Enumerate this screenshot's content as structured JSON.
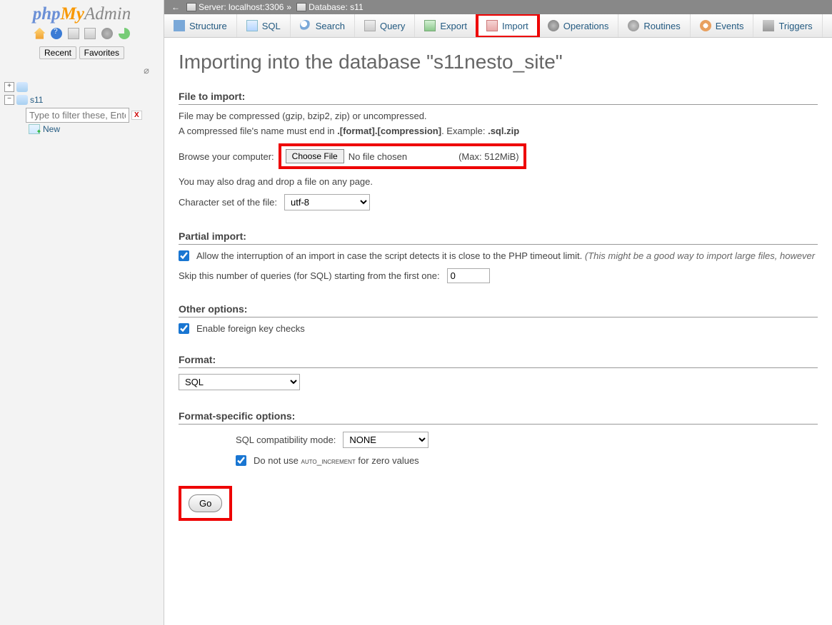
{
  "logo": {
    "p1": "php",
    "p2": "My",
    "p3": "Admin"
  },
  "sidebar": {
    "recent": "Recent",
    "favorites": "Favorites",
    "tree": {
      "db": "s11",
      "filter_placeholder": "Type to filter these, Enter to search",
      "new_label": "New"
    }
  },
  "breadcrumb": {
    "back": "←",
    "server_label": "Server:",
    "server_value": "localhost:3306",
    "sep": "»",
    "db_label": "Database:",
    "db_value": "s11"
  },
  "tabs": [
    {
      "label": "Structure",
      "icon": "ti-structure",
      "name": "tab-structure"
    },
    {
      "label": "SQL",
      "icon": "ti-sql",
      "name": "tab-sql"
    },
    {
      "label": "Search",
      "icon": "ti-search",
      "name": "tab-search"
    },
    {
      "label": "Query",
      "icon": "ti-query",
      "name": "tab-query"
    },
    {
      "label": "Export",
      "icon": "ti-export",
      "name": "tab-export"
    },
    {
      "label": "Import",
      "icon": "ti-import",
      "name": "tab-import",
      "active": true,
      "highlight": true
    },
    {
      "label": "Operations",
      "icon": "ti-ops",
      "name": "tab-operations"
    },
    {
      "label": "Routines",
      "icon": "ti-routines",
      "name": "tab-routines"
    },
    {
      "label": "Events",
      "icon": "ti-events",
      "name": "tab-events"
    },
    {
      "label": "Triggers",
      "icon": "ti-triggers",
      "name": "tab-triggers"
    }
  ],
  "heading": "Importing into the database \"s11nesto_site\"",
  "file": {
    "section": "File to import:",
    "compressed_line_a": "File may be compressed (gzip, bzip2, zip) or uncompressed.",
    "compressed_line_b1": "A compressed file's name must end in ",
    "compressed_line_b2": ".[format].[compression]",
    "compressed_line_b3": ". Example: ",
    "compressed_line_b4": ".sql.zip",
    "browse_label": "Browse your computer:",
    "choose_btn": "Choose File",
    "no_file": "No file chosen",
    "max": "(Max: 512MiB)",
    "drag_hint": "You may also drag and drop a file on any page.",
    "charset_label": "Character set of the file:",
    "charset_value": "utf-8"
  },
  "partial": {
    "section": "Partial import:",
    "allow_interrupt": "Allow the interruption of an import in case the script detects it is close to the PHP timeout limit.",
    "allow_interrupt_hint": "(This might be a good way to import large files, however",
    "skip_label": "Skip this number of queries (for SQL) starting from the first one:",
    "skip_value": "0"
  },
  "other": {
    "section": "Other options:",
    "fk_label": "Enable foreign key checks"
  },
  "format": {
    "section": "Format:",
    "value": "SQL"
  },
  "format_specific": {
    "section": "Format-specific options:",
    "compat_label": "SQL compatibility mode:",
    "compat_value": "NONE",
    "auto_inc_a": "Do not use ",
    "auto_inc_b": "auto_increment",
    "auto_inc_c": " for zero values"
  },
  "go": "Go"
}
